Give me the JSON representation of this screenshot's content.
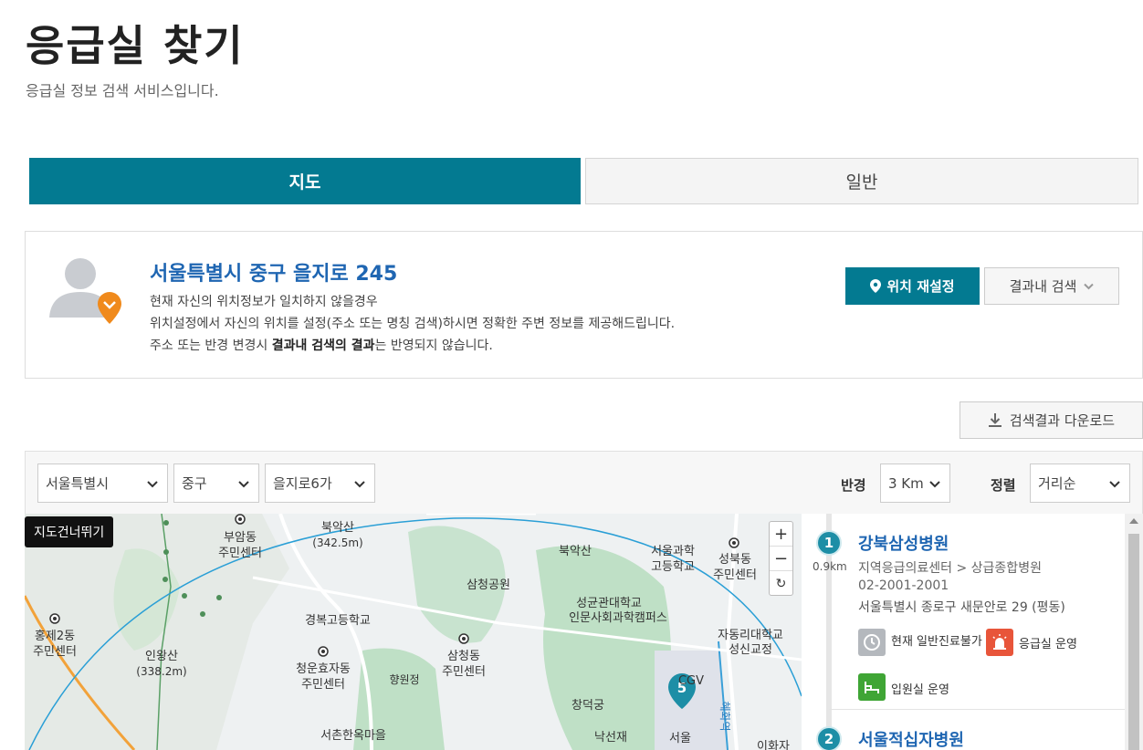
{
  "header": {
    "title": "응급실 찾기",
    "subtitle": "응급실 정보 검색 서비스입니다."
  },
  "tabs": [
    {
      "label": "지도",
      "active": true
    },
    {
      "label": "일반",
      "active": false
    }
  ],
  "location": {
    "address": "서울특별시 중구 을지로 245",
    "line1": "현재 자신의 위치정보가 일치하지 않을경우",
    "line2": "위치설정에서 자신의 위치를 설정(주소 또는 명칭 검색)하시면 정확한 주변 정보를 제공해드립니다.",
    "line3_prefix": "주소 또는 반경 변경시 ",
    "line3_bold": "결과내 검색의 결과",
    "line3_suffix": "는 반영되지 않습니다.",
    "reset_label": "위치 재설정",
    "within_label": "결과내 검색"
  },
  "download_label": "검색결과 다운로드",
  "filters": {
    "city": "서울특별시",
    "district": "중구",
    "dong": "을지로6가",
    "radius_label": "반경",
    "radius": "3 Km",
    "sort_label": "정렬",
    "sort": "거리순"
  },
  "map": {
    "skip_label": "지도건너뛰기",
    "zoom_in": "+",
    "zoom_out": "−",
    "refresh": "↻",
    "marker_number": "5",
    "labels": [
      {
        "text": "북악산"
      },
      {
        "text": "(342.5m)"
      },
      {
        "text": "부암동"
      },
      {
        "text": "주민센터"
      },
      {
        "text": "홍제2동"
      },
      {
        "text": "주민센터"
      },
      {
        "text": "인왕산"
      },
      {
        "text": "(338.2m)"
      },
      {
        "text": "삼청공원"
      },
      {
        "text": "북악산"
      },
      {
        "text": "서울과학"
      },
      {
        "text": "고등학교"
      },
      {
        "text": "성북동"
      },
      {
        "text": "주민센터"
      },
      {
        "text": "경복고등학교"
      },
      {
        "text": "성균관대학교"
      },
      {
        "text": "인문사회과학캠퍼스"
      },
      {
        "text": "자동리대학교"
      },
      {
        "text": "성신교정"
      },
      {
        "text": "청운효자동"
      },
      {
        "text": "주민센터"
      },
      {
        "text": "삼청동"
      },
      {
        "text": "주민센터"
      },
      {
        "text": "향원정"
      },
      {
        "text": "CGV"
      },
      {
        "text": "창덕궁"
      },
      {
        "text": "서촌한옥마을"
      },
      {
        "text": "낙선재"
      },
      {
        "text": "서울"
      },
      {
        "text": "혜화역"
      },
      {
        "text": "이화자"
      }
    ]
  },
  "hospitals": [
    {
      "number": "1",
      "distance": "0.9km",
      "name": "강북삼성병원",
      "category": "지역응급의료센터 > 상급종합병원",
      "phone": "02-2001-2001",
      "address": "서울특별시 종로구 새문안로 29 (평동)",
      "status_general": "현재 일반진료불가",
      "status_er": "응급실 운영",
      "status_ward": "입원실 운영"
    },
    {
      "number": "2",
      "name": "서울적십자병원"
    }
  ],
  "colors": {
    "primary": "#037a91",
    "link": "#1f66b2",
    "orange": "#f08a1c",
    "green": "#3fa535",
    "red": "#e8553a"
  }
}
